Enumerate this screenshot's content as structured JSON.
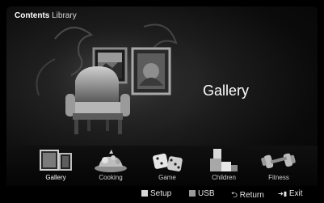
{
  "header": {
    "title_bold": "Contents",
    "title_rest": "Library"
  },
  "preview": {
    "label": "Gallery"
  },
  "categories": [
    {
      "label": "Gallery",
      "icon": "gallery-icon",
      "selected": true
    },
    {
      "label": "Cooking",
      "icon": "cooking-icon",
      "selected": false
    },
    {
      "label": "Game",
      "icon": "dice-icon",
      "selected": false
    },
    {
      "label": "Children",
      "icon": "toy-blocks-icon",
      "selected": false
    },
    {
      "label": "Fitness",
      "icon": "dumbbell-icon",
      "selected": false
    }
  ],
  "bottom_bar": {
    "setup": "Setup",
    "usb": "USB",
    "return": "Return",
    "exit": "Exit"
  },
  "colors": {
    "setup_key": "#d7d7d7",
    "usb_key": "#9a9a9a"
  }
}
